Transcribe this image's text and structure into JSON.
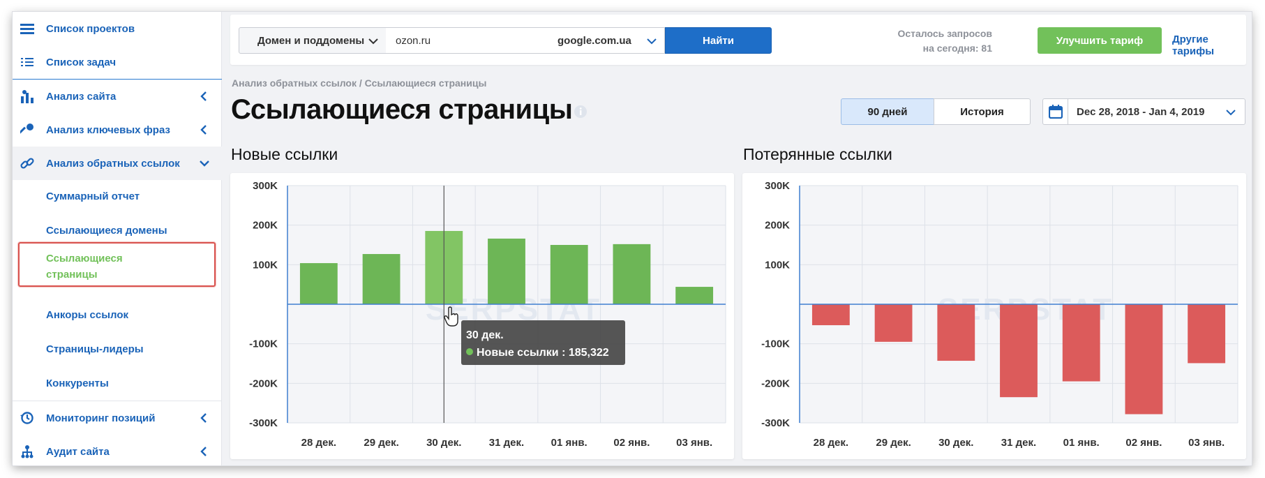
{
  "sidebar": {
    "items": [
      {
        "label": "Список проектов",
        "icon": "menu-icon"
      },
      {
        "label": "Список задач",
        "icon": "list-icon"
      },
      {
        "label": "Анализ сайта",
        "icon": "site-analysis-icon"
      },
      {
        "label": "Анализ ключевых фраз",
        "icon": "key-icon"
      },
      {
        "label": "Анализ обратных ссылок",
        "icon": "link-icon"
      },
      {
        "label": "Мониторинг позиций",
        "icon": "history-icon"
      },
      {
        "label": "Аудит сайта",
        "icon": "sitemap-icon"
      }
    ],
    "subitems": [
      "Суммарный отчет",
      "Ссылающиеся домены",
      "Ссылающиеся страницы",
      "Анкоры ссылок",
      "Страницы-лидеры",
      "Конкуренты"
    ],
    "active_sub_line1": "Ссылающиеся",
    "active_sub_line2": "страницы"
  },
  "search": {
    "scope": "Домен и поддомены",
    "domain": "ozon.ru",
    "engine": "google.com.ua",
    "find_label": "Найти",
    "requests_line1": "Осталось запросов",
    "requests_line2": "на сегодня: 81",
    "upgrade_label": "Улучшить тариф",
    "tariffs_label": "Другие тарифы"
  },
  "header": {
    "breadcrumb": "Анализ обратных ссылок / Ссылающиеся страницы",
    "title": "Ссылающиеся страницы",
    "period_90": "90 дней",
    "period_history": "История",
    "date_range": "Dec 28, 2018 - Jan 4, 2019"
  },
  "colors": {
    "accent": "#1a63b8",
    "new": "#6db656",
    "new_hover": "#82c564",
    "lost": "#dc5b5b",
    "active": "#72c15a"
  },
  "tooltip": {
    "date": "30 дек.",
    "series": "Новые ссылки",
    "value": "185,322"
  },
  "chart_data": [
    {
      "type": "bar",
      "title": "Новые ссылки",
      "categories": [
        "28 дек.",
        "29 дек.",
        "30 дек.",
        "31 дек.",
        "01 янв.",
        "02 янв.",
        "03 янв."
      ],
      "values": [
        104000,
        127000,
        185322,
        166000,
        150000,
        152000,
        44000
      ],
      "ylim": [
        -300000,
        300000
      ],
      "yticks": [
        "300K",
        "200K",
        "100K",
        "",
        "-100K",
        "-200K",
        "-300K"
      ],
      "grid": true,
      "highlight_index": 2
    },
    {
      "type": "bar",
      "title": "Потерянные ссылки",
      "categories": [
        "28 дек.",
        "29 дек.",
        "30 дек.",
        "31 дек.",
        "01 янв.",
        "02 янв.",
        "03 янв."
      ],
      "values": [
        -53000,
        -95000,
        -143000,
        -235000,
        -195000,
        -278000,
        -149000
      ],
      "ylim": [
        -300000,
        300000
      ],
      "yticks": [
        "300K",
        "200K",
        "100K",
        "",
        "-100K",
        "-200K",
        "-300K"
      ],
      "grid": true
    }
  ]
}
